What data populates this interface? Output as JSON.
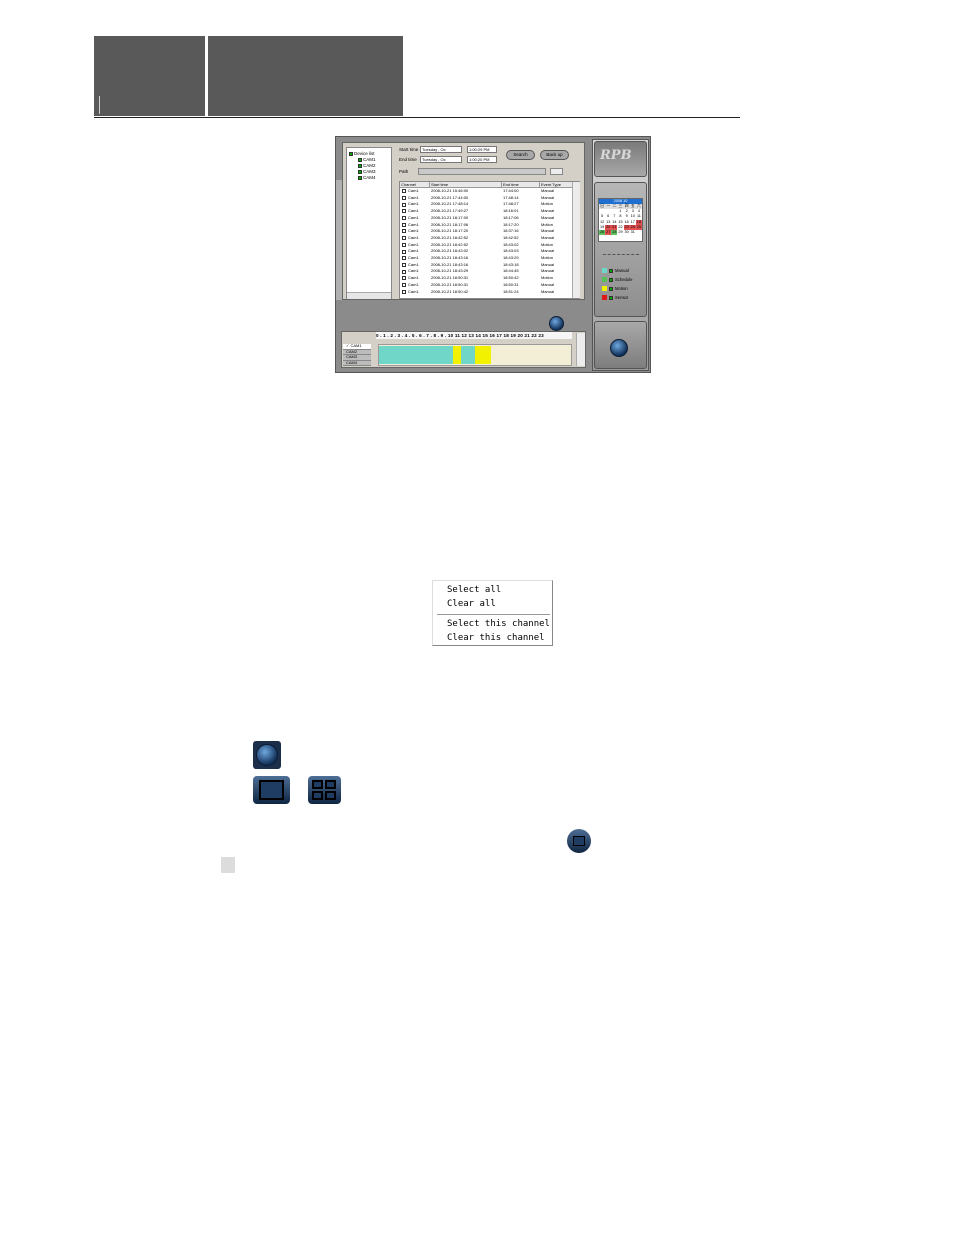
{
  "app": {
    "logo": "RPB"
  },
  "search_panel": {
    "device_list": {
      "root": "Device list",
      "cams": [
        "CAM1",
        "CAM2",
        "CAM3",
        "CAM4"
      ]
    },
    "start_time_label": "Start time",
    "end_time_label": "End time",
    "path_label": "Path",
    "start_date": "Tuesday  ,  Oc",
    "start_clock": "1:00:29 PM",
    "end_date": "Tuesday  ,  Oc",
    "end_clock": "1:00:20 PM",
    "search_button": "Search",
    "backup_button": "Back up",
    "columns": [
      "Channel",
      "Start time",
      "End time",
      "Event Type"
    ],
    "rows": [
      {
        "channel": "Cam1",
        "start": "2008-10-21 15:46:00",
        "end": "17:44:00",
        "type": "Manual"
      },
      {
        "channel": "Cam1",
        "start": "2008-10-21 17:44:00",
        "end": "17:48:14",
        "type": "Manual"
      },
      {
        "channel": "Cam1",
        "start": "2008-10-21 17:48:14",
        "end": "17:48:27",
        "type": "Motion"
      },
      {
        "channel": "Cam1",
        "start": "2008-10-21 17:49:27",
        "end": "18:16:01",
        "type": "Manual"
      },
      {
        "channel": "Cam1",
        "start": "2008-10-21 18:17:00",
        "end": "18:17:06",
        "type": "Manual"
      },
      {
        "channel": "Cam1",
        "start": "2008-10-21 18:17:06",
        "end": "18:17:20",
        "type": "Motion"
      },
      {
        "channel": "Cam1",
        "start": "2008-10-21 18:17:20",
        "end": "18:37:16",
        "type": "Manual"
      },
      {
        "channel": "Cam1",
        "start": "2008-10-21 18:42:52",
        "end": "18:42:52",
        "type": "Manual"
      },
      {
        "channel": "Cam1",
        "start": "2008-10-21 18:42:52",
        "end": "18:43:02",
        "type": "Motion"
      },
      {
        "channel": "Cam1",
        "start": "2008-10-21 18:43:02",
        "end": "18:43:03",
        "type": "Manual"
      },
      {
        "channel": "Cam1",
        "start": "2008-10-21 18:43:16",
        "end": "18:43:29",
        "type": "Motion"
      },
      {
        "channel": "Cam1",
        "start": "2008-10-21 18:43:16",
        "end": "18:43:18",
        "type": "Manual"
      },
      {
        "channel": "Cam1",
        "start": "2008-10-21 18:43:29",
        "end": "18:44:45",
        "type": "Manual"
      },
      {
        "channel": "Cam1",
        "start": "2008-10-21 18:50:31",
        "end": "18:50:42",
        "type": "Motion"
      },
      {
        "channel": "Cam1",
        "start": "2008-10-21 18:50:31",
        "end": "18:50:31",
        "type": "Manual"
      },
      {
        "channel": "Cam1",
        "start": "2008-10-21 18:50:42",
        "end": "18:51:24",
        "type": "Manual"
      }
    ]
  },
  "timeline": {
    "hours": "0 . 1 . 2 . 3 . 4 . 5 . 6 . 7 . 8 . 9 . 10 11 12 13 14 15 16 17 18 19 20 21 22 23",
    "cams": [
      "CAM1",
      "CAM2",
      "CAM3",
      "CAM4"
    ],
    "selected_cam": "CAM1"
  },
  "calendar": {
    "header": "2008 10",
    "weekdays": [
      "日",
      "一",
      "二",
      "三",
      "四",
      "五",
      "六"
    ],
    "cells": [
      "",
      "",
      "",
      "1",
      "2",
      "3",
      "4",
      "5",
      "6",
      "7",
      "8",
      "9",
      "10",
      "11",
      "12",
      "13",
      "14",
      "15",
      "16",
      "17",
      "18",
      "19",
      "20",
      "21",
      "22",
      "23",
      "24",
      "25",
      "26",
      "27",
      "28",
      "29",
      "30",
      "31",
      "",
      ""
    ]
  },
  "legend": [
    {
      "label": "Manual",
      "color": "#6fd6c8"
    },
    {
      "label": "Schedule",
      "color": "#58c058"
    },
    {
      "label": "Motion",
      "color": "#f2f200"
    },
    {
      "label": "Sensor",
      "color": "#e01818"
    }
  ],
  "context_menu": {
    "items": [
      "Select all",
      "Clear all",
      "Select this channel",
      "Clear this channel"
    ]
  },
  "colors": {
    "header_block": "#595959",
    "manual": "#6fd6c8",
    "motion": "#f2f200"
  }
}
